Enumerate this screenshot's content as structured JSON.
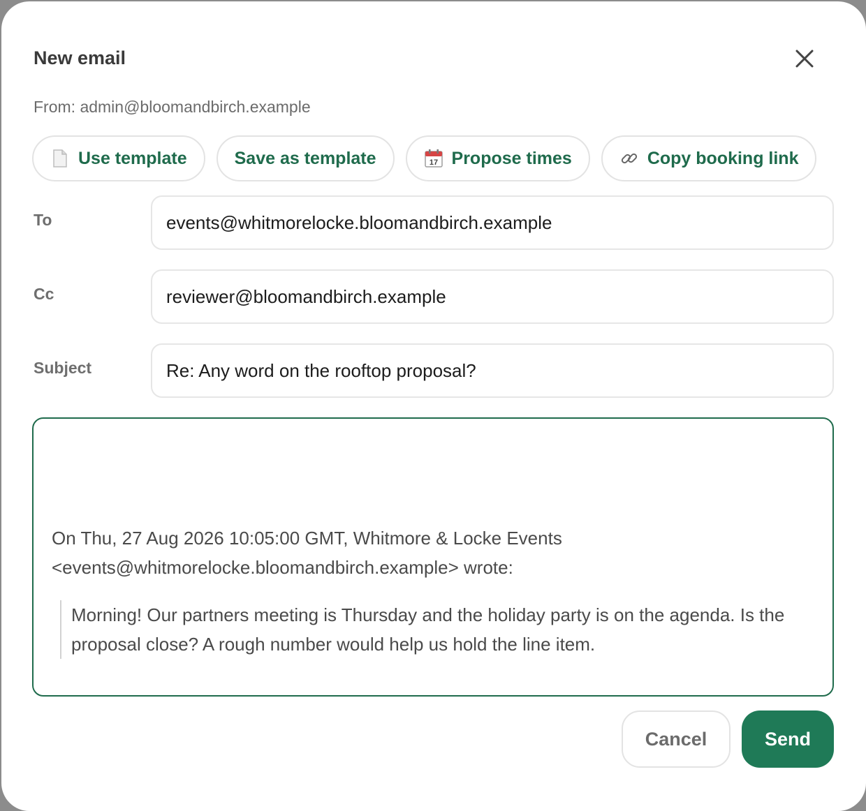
{
  "dialog": {
    "title": "New email",
    "from": "From: admin@bloomandbirch.example"
  },
  "toolbar": {
    "use_template": {
      "label": "Use template",
      "icon": "page-icon"
    },
    "save_template": {
      "label": "Save as template"
    },
    "propose_times": {
      "label": "Propose times",
      "icon": "calendar-icon",
      "icon_text": "17"
    },
    "copy_link": {
      "label": "Copy booking link",
      "icon": "link-icon"
    }
  },
  "fields": {
    "to": {
      "label": "To",
      "value": "events@whitmorelocke.bloomandbirch.example"
    },
    "cc": {
      "label": "Cc",
      "value": "reviewer@bloomandbirch.example"
    },
    "subject": {
      "label": "Subject",
      "value": "Re: Any word on the rooftop proposal?"
    }
  },
  "body": {
    "quote_header_line1": "On Thu, 27 Aug 2026 10:05:00 GMT, Whitmore & Locke Events",
    "quote_header_line2": "<events@whitmorelocke.bloomandbirch.example> wrote:",
    "quoted_text": "Morning! Our partners meeting is Thursday and the holiday party is on the agenda. Is the proposal close? A rough number would help us hold the line item."
  },
  "actions": {
    "cancel": "Cancel",
    "send": "Send"
  },
  "colors": {
    "accent": "#1f6b4c",
    "send_bg": "#1f7a57"
  }
}
